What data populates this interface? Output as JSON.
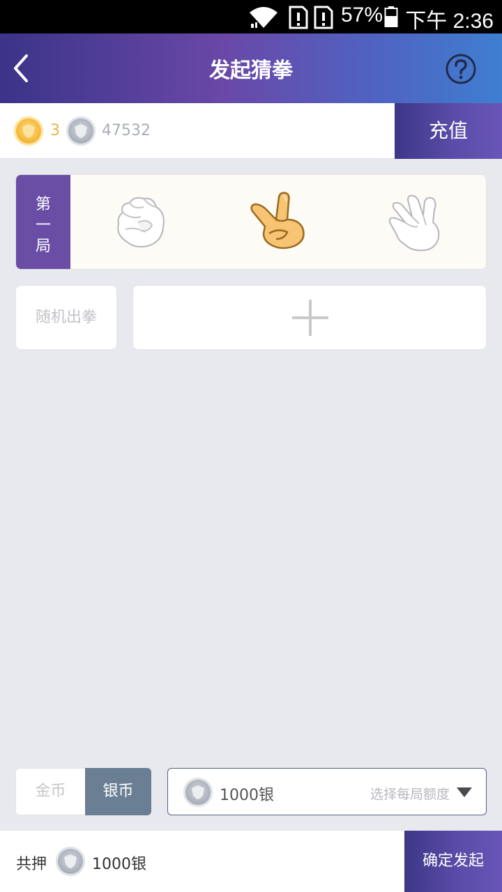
{
  "status_bar": {
    "battery_percent": "57%",
    "time": "下午 2:36",
    "icons": [
      "wifi-icon",
      "sim-alert-icon",
      "sim-alert-icon",
      "battery-icon"
    ]
  },
  "header": {
    "title": "发起猜拳",
    "back_icon": "chevron-left-icon",
    "help_icon": "question-circle-icon"
  },
  "balance": {
    "gold_count": "3",
    "silver_count": "47532",
    "recharge_label": "充值"
  },
  "round": {
    "label": "第一局",
    "gestures": [
      "rock",
      "scissors",
      "paper"
    ],
    "selected": "scissors"
  },
  "actions": {
    "random_label": "随机出拳",
    "add_icon": "plus-icon"
  },
  "currency": {
    "gold_label": "金币",
    "silver_label": "银币",
    "selected": "silver"
  },
  "amount": {
    "value": "1000银",
    "hint": "选择每局额度"
  },
  "footer": {
    "total_label": "共押",
    "total_amount": "1000银",
    "confirm_label": "确定发起"
  },
  "colors": {
    "accent_purple": "#6a4ea6",
    "gold": "#f0b23a",
    "silver_toggle": "#6a7f93",
    "background": "#e8e9ef"
  }
}
